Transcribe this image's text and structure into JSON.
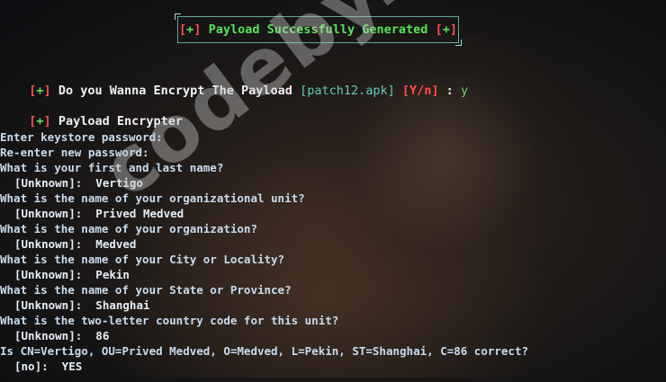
{
  "banner": {
    "bracket_open": "[",
    "plus": "+",
    "bracket_close": "]",
    "text": "Payload Successfully Generated"
  },
  "encrypt_prompt": {
    "question": "Do you Wanna Encrypt The Payload",
    "file": "[patch12.apk]",
    "yn": "[Y/n]",
    "colon": ":",
    "answer": "y"
  },
  "encrypter_label": "Payload Encrypter",
  "keytool": {
    "lines": [
      {
        "text": "Enter keystore password:",
        "indent": false
      },
      {
        "text": "Re-enter new password:",
        "indent": false
      },
      {
        "text": "What is your first and last name?",
        "indent": false
      },
      {
        "text": "[Unknown]:  Vertigo",
        "indent": true
      },
      {
        "text": "What is the name of your organizational unit?",
        "indent": false
      },
      {
        "text": "[Unknown]:  Prived Medved",
        "indent": true
      },
      {
        "text": "What is the name of your organization?",
        "indent": false
      },
      {
        "text": "[Unknown]:  Medved",
        "indent": true
      },
      {
        "text": "What is the name of your City or Locality?",
        "indent": false
      },
      {
        "text": "[Unknown]:  Pekin",
        "indent": true
      },
      {
        "text": "What is the name of your State or Province?",
        "indent": false
      },
      {
        "text": "[Unknown]:  Shanghai",
        "indent": true
      },
      {
        "text": "What is the two-letter country code for this unit?",
        "indent": false
      },
      {
        "text": "[Unknown]:  86",
        "indent": true
      },
      {
        "text": "Is CN=Vertigo, OU=Prived Medved, O=Medved, L=Pekin, ST=Shanghai, C=86 correct?",
        "indent": false
      },
      {
        "text": "[no]:  YES",
        "indent": true
      }
    ]
  },
  "watermark": "codeby.net",
  "colors": {
    "bracket": "#ff4d4d",
    "plus": "#57e357",
    "text": "#c9dcef"
  }
}
